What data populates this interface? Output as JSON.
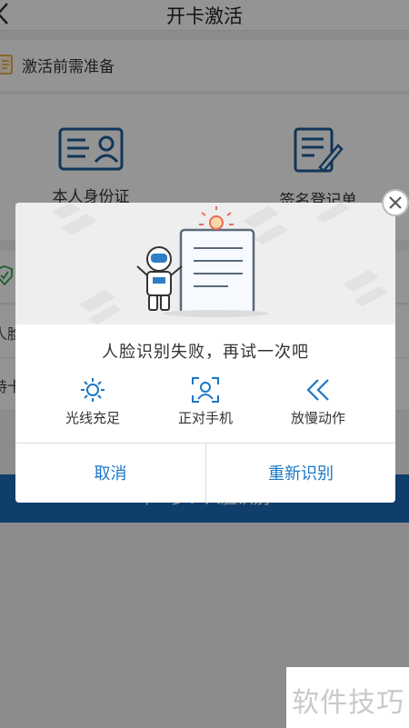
{
  "navbar": {
    "title": "开卡激活"
  },
  "prep": {
    "label": "激活前需准备"
  },
  "docs": [
    {
      "label": "本人身份证"
    },
    {
      "label": "签名登记单"
    }
  ],
  "rows": [
    {
      "text": ""
    },
    {
      "text": "人脸"
    },
    {
      "text": "持卡"
    }
  ],
  "main_button": {
    "label": "下一步：人脸识别"
  },
  "dialog": {
    "message": "人脸识别失败，再试一次吧",
    "tips": [
      {
        "icon": "sun-icon",
        "label": "光线充足"
      },
      {
        "icon": "face-frame-icon",
        "label": "正对手机"
      },
      {
        "icon": "double-chevron-left-icon",
        "label": "放慢动作"
      }
    ],
    "cancel_label": "取消",
    "retry_label": "重新识别"
  },
  "watermark": {
    "text": "软件技巧"
  },
  "colors": {
    "accent": "#1a78c8",
    "primary_button": "#1c6bb8",
    "overlay": "rgba(0,0,0,0.42)"
  }
}
